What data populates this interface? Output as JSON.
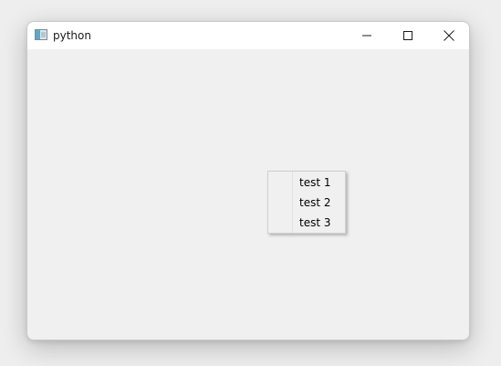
{
  "window": {
    "title": "python",
    "app_icon": "python-window-icon"
  },
  "titlebar_controls": {
    "minimize_icon": "minimize-icon",
    "maximize_icon": "maximize-icon",
    "close_icon": "close-icon"
  },
  "context_menu": {
    "items": [
      {
        "label": "test 1"
      },
      {
        "label": "test 2"
      },
      {
        "label": "test 3"
      }
    ]
  },
  "colors": {
    "window_background": "#f0f0f0",
    "titlebar_background": "#ffffff",
    "menu_background": "#f0f0f0"
  }
}
